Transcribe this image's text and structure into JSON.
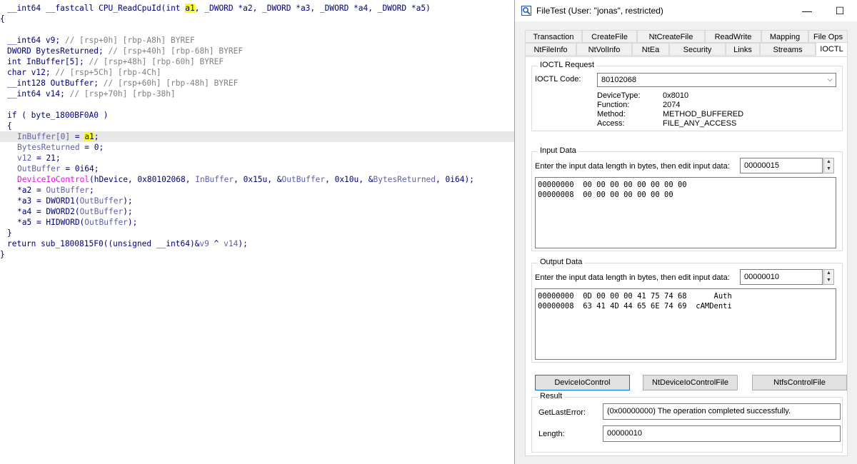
{
  "code": {
    "signature": {
      "ret": "__int64",
      "conv": "__fastcall",
      "name": "CPU_ReadCpuId",
      "open": "(",
      "arg1_type": "int ",
      "arg1": "a1",
      "rest": ", _DWORD *a2, _DWORD *a3, _DWORD *a4, _DWORD *a5)"
    },
    "brace_open": "{",
    "decls": [
      {
        "decl": "__int64 v9;",
        "comment": "// [rsp+0h] [rbp-A8h] BYREF"
      },
      {
        "decl": "DWORD BytesReturned;",
        "comment": "// [rsp+40h] [rbp-68h] BYREF"
      },
      {
        "decl": "int InBuffer[5];",
        "comment": "// [rsp+48h] [rbp-60h] BYREF"
      },
      {
        "decl": "char v12;",
        "comment": "// [rsp+5Ch] [rbp-4Ch]"
      },
      {
        "decl": "__int128 OutBuffer;",
        "comment": "// [rsp+60h] [rbp-48h] BYREF"
      },
      {
        "decl": "__int64 v14;",
        "comment": "// [rsp+70h] [rbp-38h]"
      }
    ],
    "if_line": "if ( byte_1800BF0A0 )",
    "if_brace": "{",
    "body": {
      "l1_var": "InBuffer[0]",
      "l1_op": " = ",
      "l1_val": "a1",
      "l1_end": ";",
      "l2_var": "BytesReturned",
      "l2_rest": " = 0;",
      "l3_var": "v12",
      "l3_rest": " = 21;",
      "l4_var": "OutBuffer",
      "l4_rest": " = 0i64;",
      "l5_fn": "DeviceIoControl",
      "l5_a": "(hDevice, 0x80102068, ",
      "l5_b": "InBuffer",
      "l5_c": ", 0x15u, &",
      "l5_d": "OutBuffer",
      "l5_e": ", 0x10u, &",
      "l5_f": "BytesReturned",
      "l5_g": ", 0i64);",
      "l6_a": "*a2 = ",
      "l6_b": "OutBuffer",
      "l6_c": ";",
      "l7_a": "*a3 = DWORD1(",
      "l7_b": "OutBuffer",
      "l7_c": ");",
      "l8_a": "*a4 = DWORD2(",
      "l8_b": "OutBuffer",
      "l8_c": ");",
      "l9_a": "*a5 = HIDWORD(",
      "l9_b": "OutBuffer",
      "l9_c": ");"
    },
    "if_close": "}",
    "ret_a": "return sub_1800815F0((unsigned __int64)&",
    "ret_b": "v9",
    "ret_c": " ^ ",
    "ret_d": "v14",
    "ret_e": ");",
    "brace_close": "}"
  },
  "window": {
    "title": "FileTest (User: \"jonas\", restricted)",
    "controls": {
      "minimize": "—",
      "maximize": "☐",
      "close": "✕"
    },
    "tabs_row1": [
      "Transaction",
      "CreateFile",
      "NtCreateFile",
      "ReadWrite",
      "Mapping",
      "File Ops"
    ],
    "tabs_row2": [
      "NtFileInfo",
      "NtVolInfo",
      "NtEa",
      "Security",
      "Links",
      "Streams",
      "IOCTL"
    ],
    "active_tab": "IOCTL",
    "ioctl_request": {
      "group_title": "IOCTL Request",
      "code_label": "IOCTL Code:",
      "code_value": "80102068",
      "device_type_label": "DeviceType:",
      "device_type_value": "0x8010",
      "function_label": "Function:",
      "function_value": "2074",
      "method_label": "Method:",
      "method_value": "METHOD_BUFFERED",
      "access_label": "Access:",
      "access_value": "FILE_ANY_ACCESS"
    },
    "input_data": {
      "group_title": "Input Data",
      "length_label": "Enter the input data length in bytes, then edit input data:",
      "length_value": "00000015",
      "hex_lines": [
        "00000000  00 00 00 00 00 00 00 00",
        "00000008  00 00 00 00 00 00 00"
      ]
    },
    "output_data": {
      "group_title": "Output Data",
      "length_label": "Enter the input data length in bytes, then edit input data:",
      "length_value": "00000010",
      "hex_lines": [
        "00000000  0D 00 00 00 41 75 74 68      Auth",
        "00000008  63 41 4D 44 65 6E 74 69  cAMDenti"
      ]
    },
    "buttons": {
      "device_io_control": "DeviceIoControl",
      "nt_device_io_control_file": "NtDeviceIoControlFile",
      "ntfs_control_file": "NtfsControlFile"
    },
    "result": {
      "group_title": "Result",
      "last_error_label": "GetLastError:",
      "last_error_value": "(0x00000000) The operation completed successfully.",
      "length_label": "Length:",
      "length_value": "00000010"
    }
  }
}
